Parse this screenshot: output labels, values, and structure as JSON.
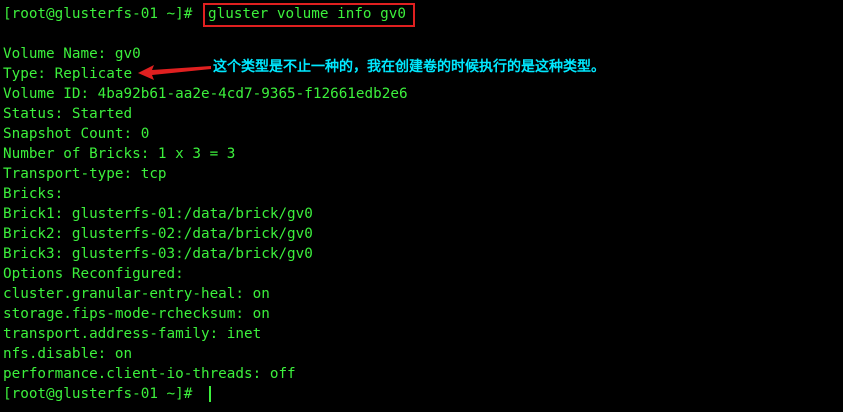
{
  "terminal": {
    "prompt_top": "[root@glusterfs-01 ~]#",
    "command": "gluster volume info gv0",
    "output_lines": [
      "Volume Name: gv0",
      "Type: Replicate",
      "Volume ID: 4ba92b61-aa2e-4cd7-9365-f12661edb2e6",
      "Status: Started",
      "Snapshot Count: 0",
      "Number of Bricks: 1 x 3 = 3",
      "Transport-type: tcp",
      "Bricks:",
      "Brick1: glusterfs-01:/data/brick/gv0",
      "Brick2: glusterfs-02:/data/brick/gv0",
      "Brick3: glusterfs-03:/data/brick/gv0",
      "Options Reconfigured:",
      "cluster.granular-entry-heal: on",
      "storage.fips-mode-rchecksum: on",
      "transport.address-family: inet",
      "nfs.disable: on",
      "performance.client-io-threads: off"
    ],
    "prompt_bottom": "[root@glusterfs-01 ~]#"
  },
  "annotation": {
    "text": "这个类型是不止一种的，我在创建卷的时候执行的是这种类型。",
    "icon": "left-arrow-icon"
  },
  "colors": {
    "background": "#000000",
    "terminal_text": "#3cf03c",
    "highlight_box": "#e02020",
    "annotation_text": "#00e8ff",
    "arrow": "#e02020"
  }
}
